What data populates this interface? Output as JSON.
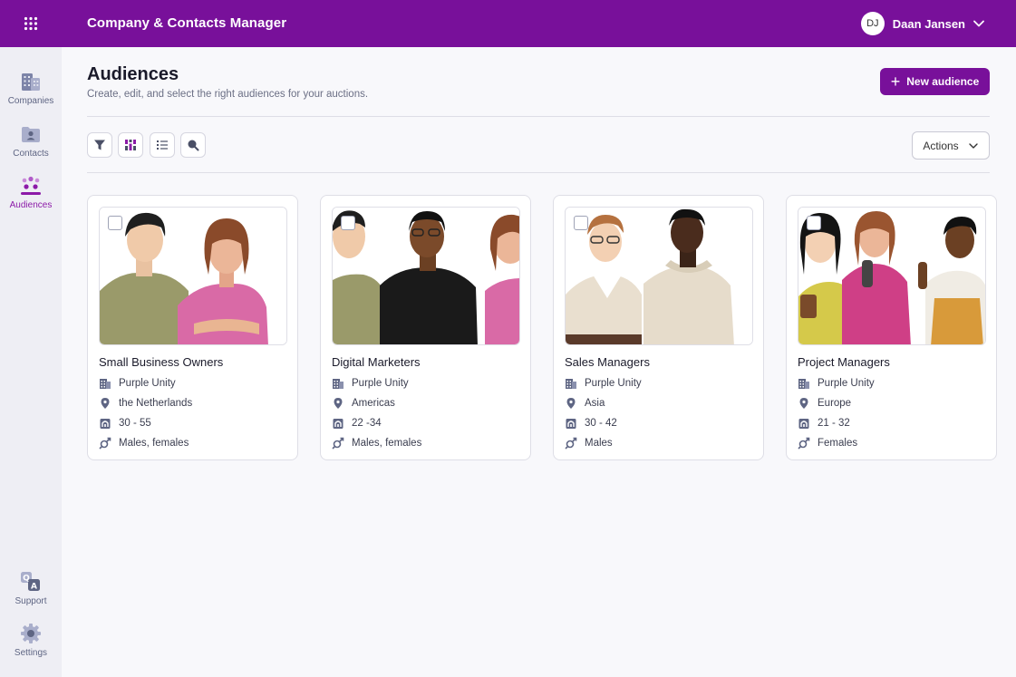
{
  "app": {
    "title": "Company & Contacts Manager"
  },
  "user": {
    "initials": "DJ",
    "name": "Daan Jansen"
  },
  "sidebar": {
    "items": [
      {
        "label": "Companies"
      },
      {
        "label": "Contacts"
      },
      {
        "label": "Audiences"
      }
    ],
    "bottom": [
      {
        "label": "Support"
      },
      {
        "label": "Settings"
      }
    ]
  },
  "page": {
    "title": "Audiences",
    "subtitle": "Create, edit, and select the right audiences for your auctions.",
    "new_button": "New audience",
    "actions_button": "Actions"
  },
  "colors": {
    "brand": "#78109a",
    "accent": "#8c1aa8"
  },
  "audiences": [
    {
      "name": "Small Business Owners",
      "company": "Purple Unity",
      "location": "the Netherlands",
      "age": "30 - 55",
      "gender": "Males, females"
    },
    {
      "name": "Digital Marketers",
      "company": "Purple Unity",
      "location": "Americas",
      "age": "22 -34",
      "gender": "Males, females"
    },
    {
      "name": "Sales Managers",
      "company": "Purple Unity",
      "location": "Asia",
      "age": "30 - 42",
      "gender": "Males"
    },
    {
      "name": "Project Managers",
      "company": "Purple Unity",
      "location": "Europe",
      "age": "21 - 32",
      "gender": "Females"
    }
  ]
}
